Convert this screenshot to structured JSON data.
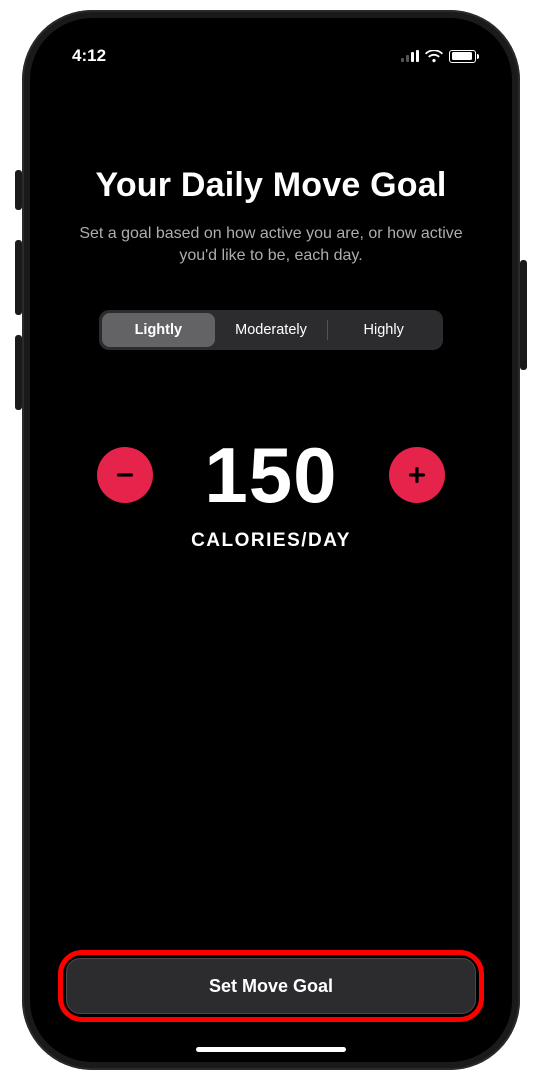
{
  "status": {
    "time": "4:12"
  },
  "header": {
    "title": "Your Daily Move Goal",
    "subtitle": "Set a goal based on how active you are, or how active you'd like to be, each day."
  },
  "segments": {
    "options": [
      {
        "label": "Lightly",
        "selected": true
      },
      {
        "label": "Moderately",
        "selected": false
      },
      {
        "label": "Highly",
        "selected": false
      }
    ]
  },
  "goal": {
    "value": "150",
    "unit": "CALORIES/DAY"
  },
  "cta": {
    "label": "Set Move Goal"
  }
}
